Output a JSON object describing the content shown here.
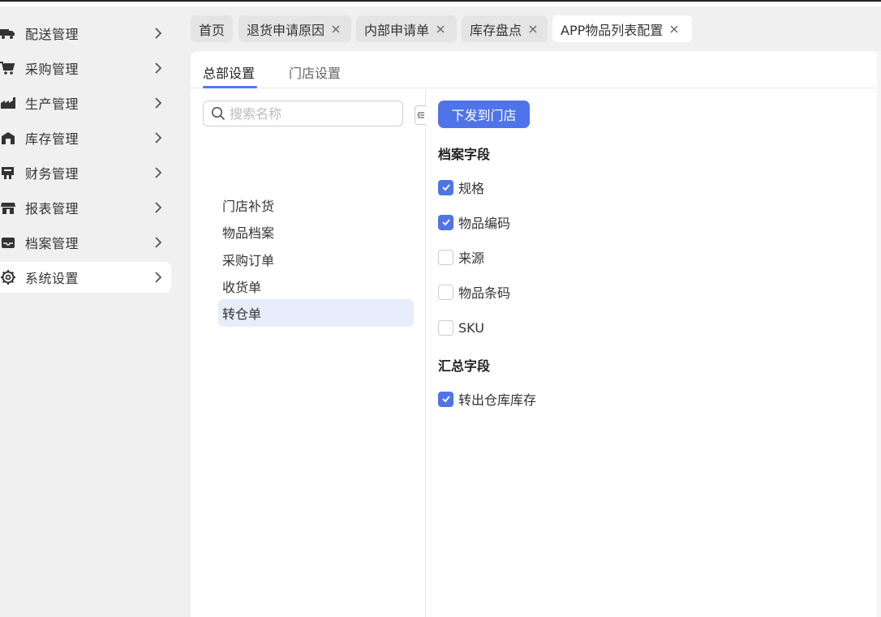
{
  "sidebar": {
    "items": [
      {
        "label": "配送管理",
        "icon": "truck-icon"
      },
      {
        "label": "采购管理",
        "icon": "cart-icon"
      },
      {
        "label": "生产管理",
        "icon": "factory-icon"
      },
      {
        "label": "库存管理",
        "icon": "warehouse-icon"
      },
      {
        "label": "财务管理",
        "icon": "finance-icon"
      },
      {
        "label": "报表管理",
        "icon": "store-icon"
      },
      {
        "label": "档案管理",
        "icon": "inbox-icon"
      },
      {
        "label": "系统设置",
        "icon": "gear-icon",
        "active": true
      }
    ]
  },
  "tabs": [
    {
      "label": "首页",
      "closable": false
    },
    {
      "label": "退货申请原因",
      "closable": true
    },
    {
      "label": "内部申请单",
      "closable": true
    },
    {
      "label": "库存盘点",
      "closable": true
    },
    {
      "label": "APP物品列表配置",
      "closable": true,
      "active": true
    }
  ],
  "subtabs": [
    {
      "label": "总部设置",
      "active": true
    },
    {
      "label": "门店设置"
    }
  ],
  "search": {
    "placeholder": "搜索名称"
  },
  "doc_list": [
    {
      "label": "门店补货"
    },
    {
      "label": "物品档案"
    },
    {
      "label": "采购订单"
    },
    {
      "label": "收货单"
    },
    {
      "label": "转仓单",
      "active": true
    }
  ],
  "actions": {
    "dispatch_label": "下发到门店"
  },
  "archive_section": {
    "title": "档案字段",
    "fields": [
      {
        "label": "规格",
        "checked": true
      },
      {
        "label": "物品编码",
        "checked": true
      },
      {
        "label": "来源",
        "checked": false
      },
      {
        "label": "物品条码",
        "checked": false
      },
      {
        "label": "SKU",
        "checked": false
      }
    ]
  },
  "summary_section": {
    "title": "汇总字段",
    "fields": [
      {
        "label": "转出仓库库存",
        "checked": true
      }
    ]
  },
  "colors": {
    "accent": "#4f73e8",
    "active_bg": "#e8edfb"
  }
}
